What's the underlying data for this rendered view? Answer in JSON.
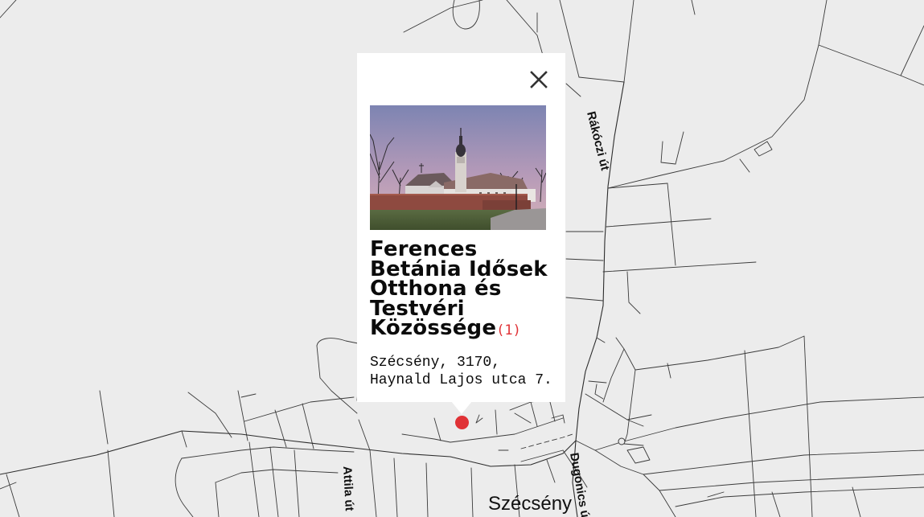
{
  "map": {
    "streets": [
      "Rákóczi út",
      "Attila út",
      "Dugonics út"
    ],
    "town": "Szécsény"
  },
  "popup": {
    "title": "Ferences Betánia Idősek Otthona és Testvéri Közössége",
    "review_count": "(1)",
    "address_line1": "Szécsény, 3170,",
    "address_line2": "Haynald Lajos utca 7.",
    "close_icon": "close-icon",
    "photo_subject": "church-photo"
  },
  "colors": {
    "map_background": "#ececec",
    "road_line": "#3a3a3a",
    "marker": "#e03236",
    "review_count": "#e03236",
    "popup_background": "#ffffff"
  }
}
